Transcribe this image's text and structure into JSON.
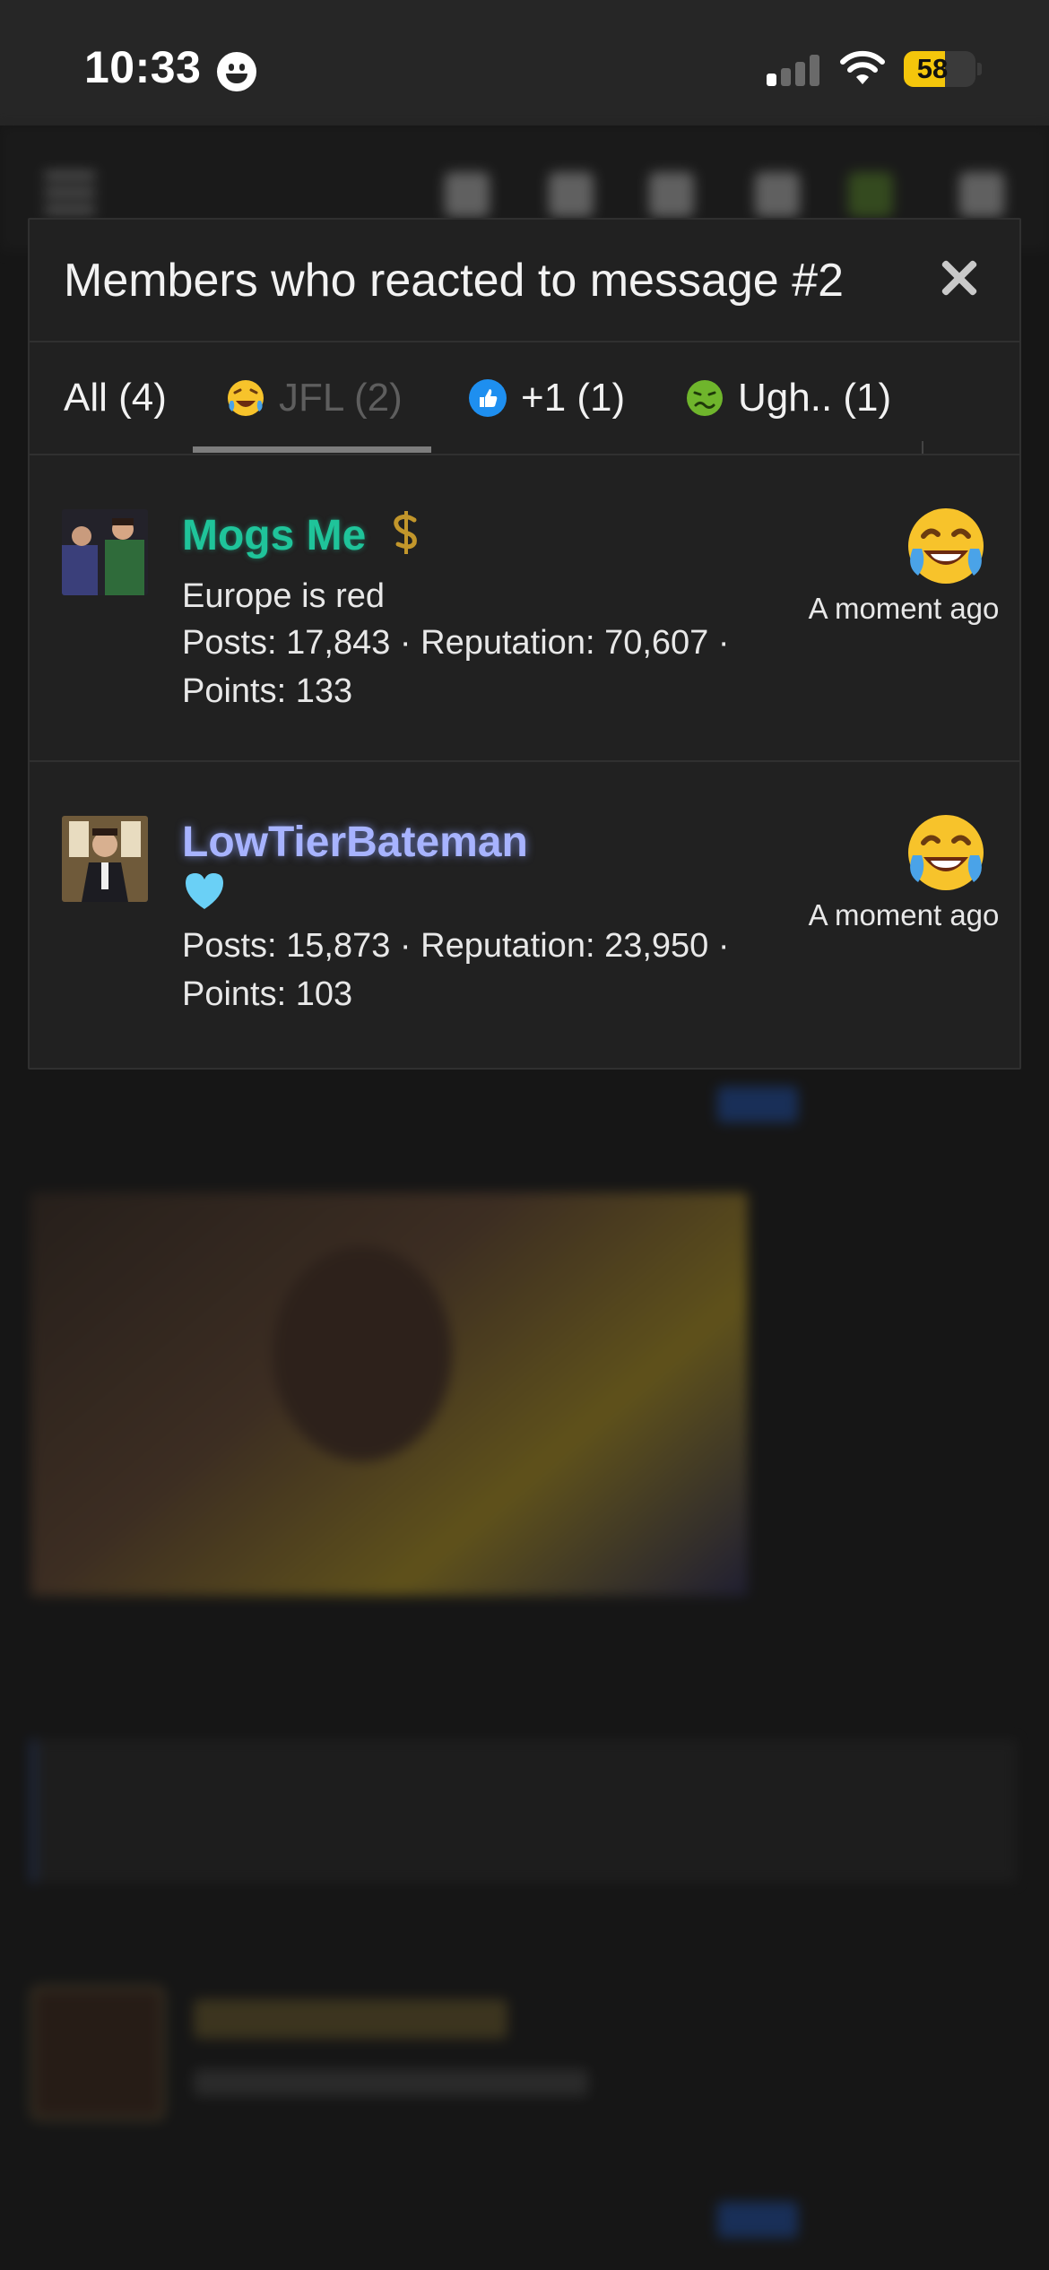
{
  "status_bar": {
    "time": "10:33",
    "battery": "58",
    "battery_level": 0.58,
    "signal_bars_active": 1,
    "colors": {
      "battery": "#f4c60b"
    }
  },
  "modal": {
    "title": "Members who reacted to message #2",
    "close_icon": "close-icon",
    "tabs": [
      {
        "label": "All (4)",
        "emoji": null,
        "active": false
      },
      {
        "label": "JFL (2)",
        "emoji": "face-with-tears-of-joy-icon",
        "active": true
      },
      {
        "label": "+1 (1)",
        "emoji": "thumbs-up-icon",
        "active": false
      },
      {
        "label": "Ugh.. (1)",
        "emoji": "nauseated-face-icon",
        "active": false
      }
    ],
    "members": [
      {
        "name": "Mogs Me",
        "name_color": "#1fc49a",
        "badge": "dollar-sign-icon",
        "title": "Europe is red",
        "stats": "Posts: 17,843 · Reputation: 70,607 · Points: 133",
        "reaction_icon": "face-with-tears-of-joy-icon",
        "time": "A moment ago"
      },
      {
        "name": "LowTierBateman",
        "name_color": "#a7b3ff",
        "badge": "light-blue-heart-icon",
        "title": "",
        "stats": "Posts: 15,873 · Reputation: 23,950 · Points: 103",
        "reaction_icon": "face-with-tears-of-joy-icon",
        "time": "A moment ago"
      }
    ]
  }
}
